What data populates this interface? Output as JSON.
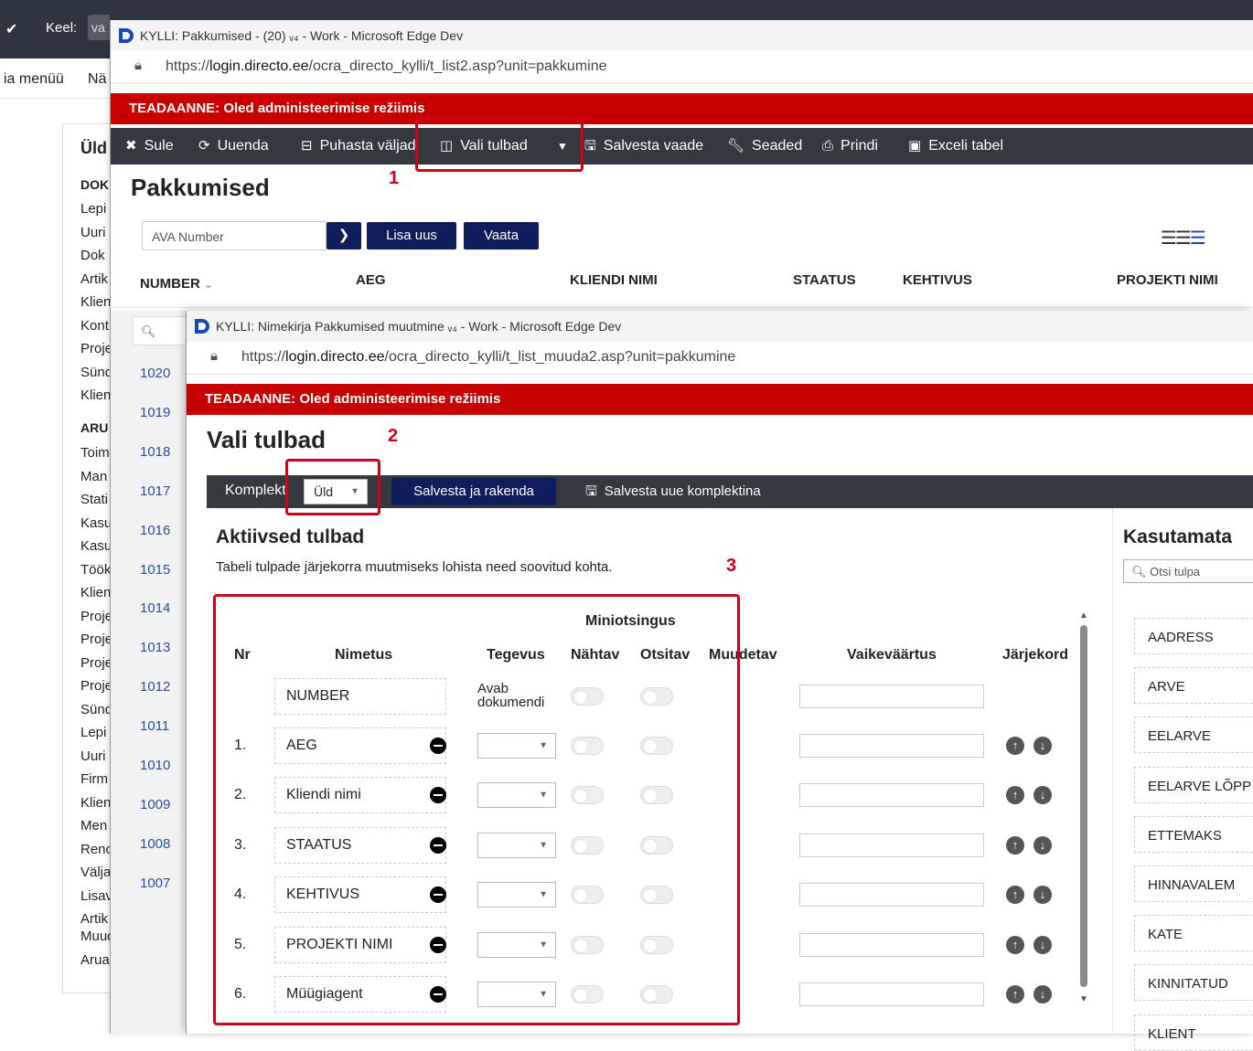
{
  "background": {
    "lang_label": "Keel:",
    "lang_value": "va",
    "menu_left": "ia menüü",
    "menu_next": "Nä",
    "panel_title": "Üld",
    "section1": "DOK",
    "items1": [
      "Lepi",
      "Uuri",
      "Dok",
      "Artik",
      "Klien",
      "Kont",
      "Proje",
      "Sünd",
      "Klien"
    ],
    "section2": "ARU",
    "items2": [
      "Toim",
      "Man",
      "Stati",
      "Kasu",
      "Kasu",
      "Töök",
      "Klien",
      "Proje",
      "Proje",
      "Proje",
      "Proje",
      "Sünd",
      "Lepi",
      "Uuri",
      "Firm",
      "Klien",
      "Men",
      "Renc",
      "Välja",
      "Lisav",
      "Artik"
    ],
    "items3": [
      "Muudatused",
      "Aruande koosta"
    ]
  },
  "win1": {
    "title": "KYLLI: Pakkumised - (20) ᵥ₄ - Work - Microsoft Edge Dev",
    "url_prefix": "https://",
    "url_host": "login.directo.ee",
    "url_path": "/ocra_directo_kylli/t_list2.asp?unit=pakkumine",
    "admin_notice": "TEADAANNE:  Oled administeerimise režiimis",
    "toolbar": {
      "close": "Sule",
      "refresh": "Uuenda",
      "clear": "Puhasta väljad",
      "choose_columns": "Vali tulbad",
      "save_view": "Salvesta vaade",
      "settings": "Seaded",
      "print": "Prindi",
      "excel": "Exceli tabel"
    },
    "page_title": "Pakkumised",
    "search_placeholder": "AVA Number",
    "add_new": "Lisa uus",
    "view": "Vaata",
    "columns": [
      "NUMBER",
      "AEG",
      "KLIENDI NIMI",
      "STAATUS",
      "KEHTIVUS",
      "PROJEKTI NIMI"
    ],
    "rows": [
      "1020",
      "1019",
      "1018",
      "1017",
      "1016",
      "1015",
      "1014",
      "1013",
      "1012",
      "1011",
      "1010",
      "1009",
      "1008",
      "1007"
    ]
  },
  "annotations": [
    "1",
    "2",
    "3"
  ],
  "win2": {
    "title": "KYLLI: Nimekirja Pakkumised muutmine ᵥ₄ - Work - Microsoft Edge Dev",
    "url_prefix": "https://",
    "url_host": "login.directo.ee",
    "url_path": "/ocra_directo_kylli/t_list_muuda2.asp?unit=pakkumine",
    "admin_notice": "TEADAANNE:  Oled administeerimise režiimis",
    "page_title": "Vali tulbad",
    "set_label": "Komplekt",
    "set_value": "Üld",
    "save_apply": "Salvesta ja rakenda",
    "save_new_set": "Salvesta uue komplektina",
    "active_title": "Aktiivsed tulbad",
    "active_hint": "Tabeli tulpade järjekorra muutmiseks lohista need soovitud kohta.",
    "minisearch_header": "Miniotsingus",
    "headers": {
      "nr": "Nr",
      "name": "Nimetus",
      "action": "Tegevus",
      "visible": "Nähtav",
      "searchable": "Otsitav",
      "editable": "Muudetav",
      "default": "Vaikeväärtus",
      "order": "Järjekord"
    },
    "number_row": {
      "name": "NUMBER",
      "action": "Avab dokumendi"
    },
    "rows": [
      {
        "nr": "1.",
        "name": "AEG"
      },
      {
        "nr": "2.",
        "name": "Kliendi nimi"
      },
      {
        "nr": "3.",
        "name": "STAATUS"
      },
      {
        "nr": "4.",
        "name": "KEHTIVUS"
      },
      {
        "nr": "5.",
        "name": "PROJEKTI NIMI"
      },
      {
        "nr": "6.",
        "name": "Müügiagent"
      }
    ],
    "unused_title": "Kasutamata",
    "unused_search_placeholder": "Otsi tulpa",
    "unused": [
      "AADRESS",
      "ARVE",
      "EELARVE",
      "EELARVE LÕPP",
      "ETTEMAKS",
      "HINNAVALEM",
      "KATE",
      "KINNITATUD",
      "KLIENT"
    ]
  },
  "colors": {
    "admin_red": "#c90000",
    "toolbar_dark": "#34393f",
    "navy_button": "#0f1d5c",
    "annotation_red": "#d0021b",
    "link_blue": "#2a4f9e"
  }
}
